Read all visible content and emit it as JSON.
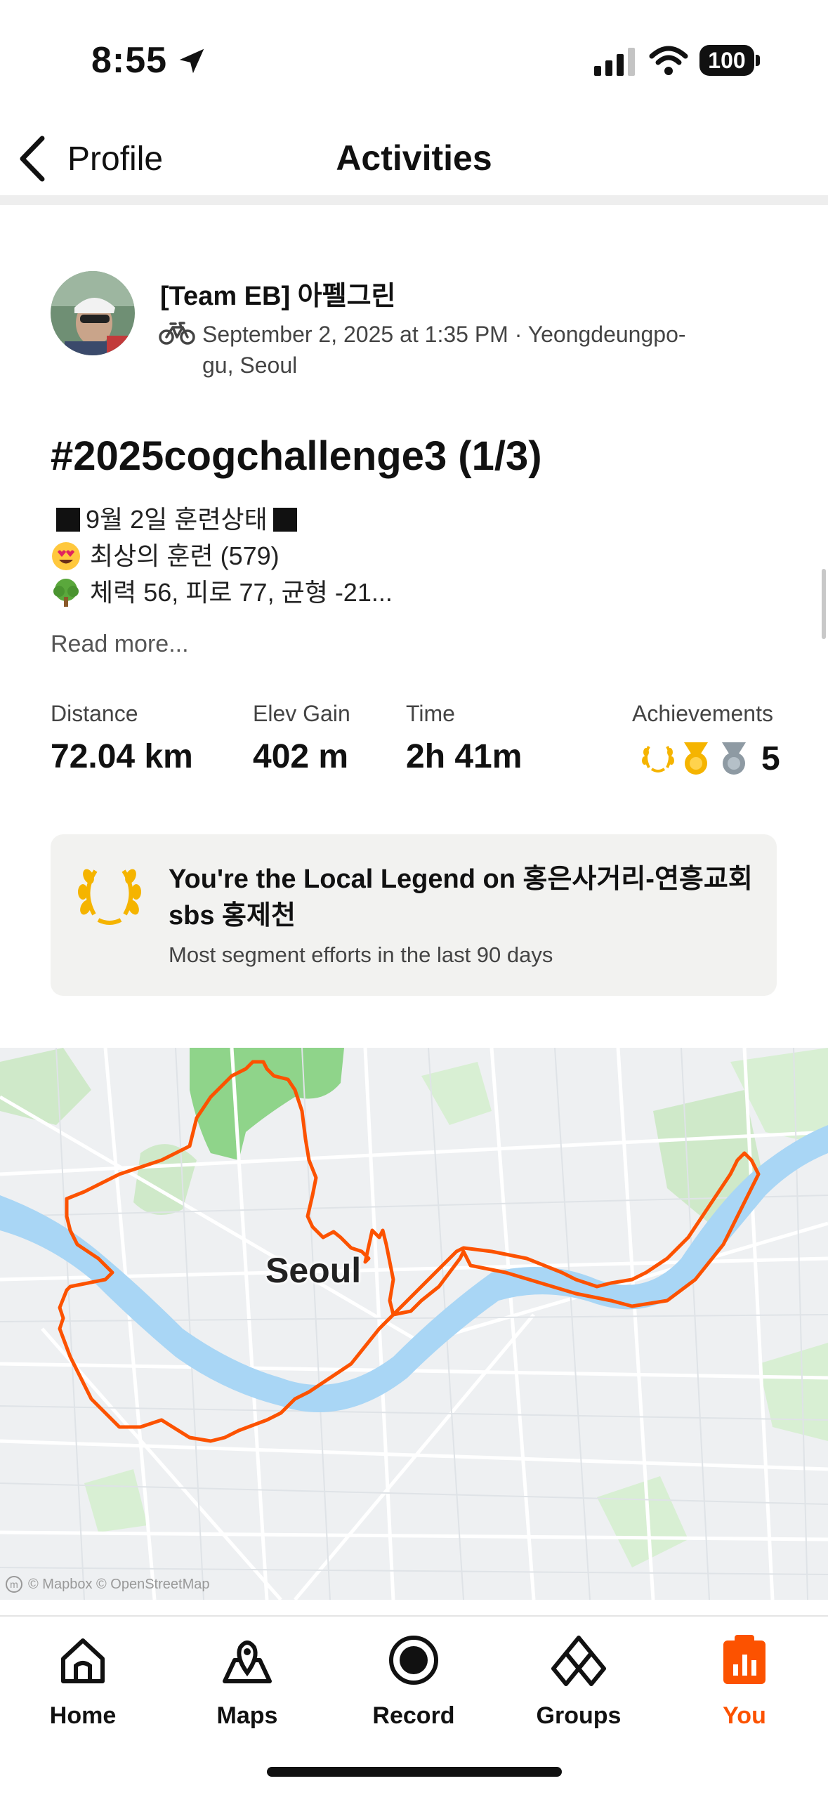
{
  "status": {
    "time": "8:55",
    "battery": "100"
  },
  "nav": {
    "back_label": "Profile",
    "title": "Activities"
  },
  "activity": {
    "athlete": "[Team EB] 아펠그린",
    "meta": "September 2, 2025 at 1:35 PM · Yeongdeungpo-gu, Seoul",
    "title": "#2025cogchallenge3 (1/3)",
    "desc_line1": "9월 2일 훈련상태",
    "desc_line2": "최상의 훈련 (579)",
    "desc_line3": "체력 56, 피로 77, 균형 -21...",
    "read_more": "Read more..."
  },
  "stats": [
    {
      "label": "Distance",
      "value": "72.04 km"
    },
    {
      "label": "Elev Gain",
      "value": "402 m"
    },
    {
      "label": "Time",
      "value": "2h 41m"
    }
  ],
  "achievements": {
    "label": "Achievements",
    "count": "5"
  },
  "legend": {
    "title": "You're the Local Legend on 홍은사거리-연흥교회 sbs 홍제천",
    "subtitle": "Most segment efforts in the last 90 days"
  },
  "map": {
    "city_label": "Seoul",
    "attribution": "© Mapbox © OpenStreetMap",
    "route_color": "#fc5200",
    "river_color": "#a9d6f5",
    "park_color": "#8fd48a"
  },
  "tabs": [
    {
      "label": "Home",
      "icon": "home-icon",
      "active": false
    },
    {
      "label": "Maps",
      "icon": "maps-icon",
      "active": false
    },
    {
      "label": "Record",
      "icon": "record-icon",
      "active": false
    },
    {
      "label": "Groups",
      "icon": "groups-icon",
      "active": false
    },
    {
      "label": "You",
      "icon": "you-icon",
      "active": true
    }
  ],
  "colors": {
    "accent": "#fc5200",
    "gold": "#f5b400"
  }
}
